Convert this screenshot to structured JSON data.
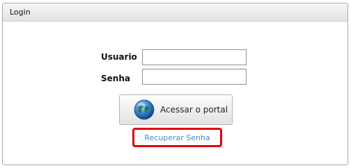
{
  "panel": {
    "title": "Login"
  },
  "form": {
    "username_label": "Usuario",
    "username_value": "",
    "password_label": "Senha",
    "password_value": "",
    "submit_label": "Acessar o portal",
    "submit_icon": "globe-icon",
    "recover_label": "Recuperar Senha"
  },
  "colors": {
    "highlight_border": "#e00000",
    "link": "#3d8fd1"
  }
}
